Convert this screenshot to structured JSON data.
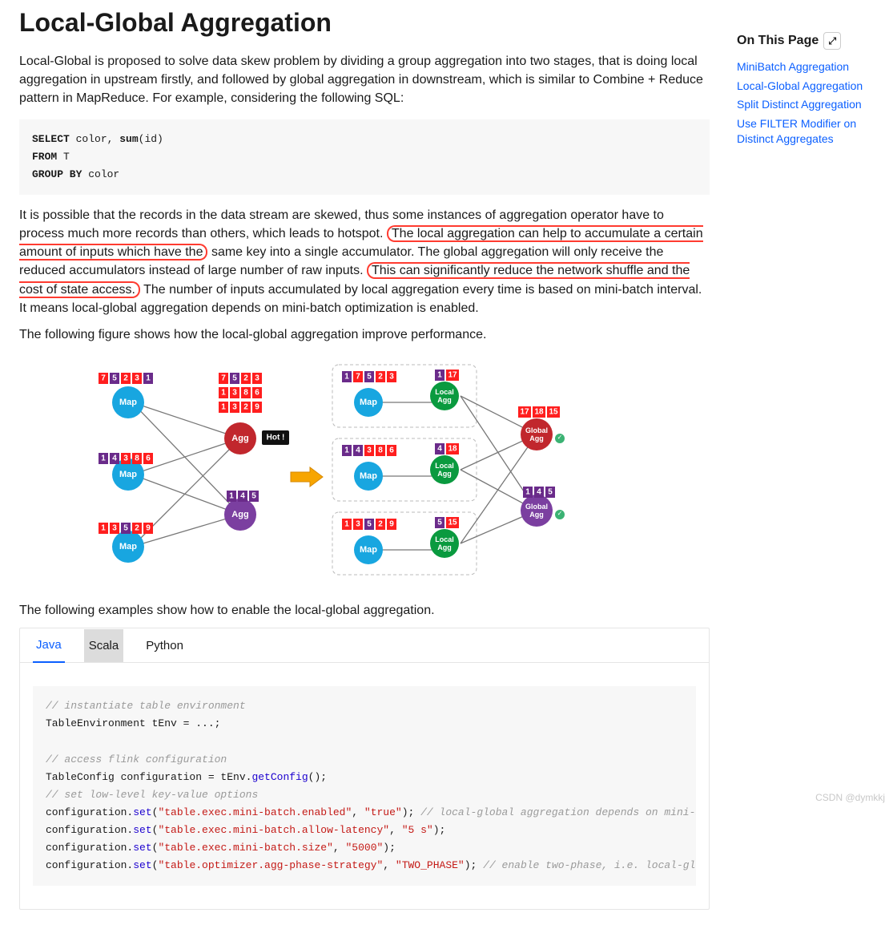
{
  "heading": "Local-Global Aggregation",
  "intro": "Local-Global is proposed to solve data skew problem by dividing a group aggregation into two stages, that is doing local aggregation in upstream firstly, and followed by global aggregation in downstream, which is similar to Combine + Reduce pattern in MapReduce. For example, considering the following SQL:",
  "sql": {
    "l1a": "SELECT",
    "l1b": " color, ",
    "l1c": "sum",
    "l1d": "(id)",
    "l2a": "FROM",
    "l2b": " T",
    "l3a": "GROUP BY",
    "l3b": " color"
  },
  "para2_a": "It is possible that the records in the data stream are skewed, thus some instances of aggregation operator have to process much more records than others, which leads to hotspot.",
  "para2_hl1": "The local aggregation can help to accumulate a certain amount of inputs which have the",
  "para2_b": "same key into a single accumulator. The global aggregation will only receive the reduced accumulators instead of large number of raw inputs.",
  "para2_hl2": "This can significantly reduce the network shuffle and the cost of state access.",
  "para2_c": "The number of inputs accumulated by local aggregation every time is based on mini-batch interval. It means local-global aggregation depends on mini-batch optimization is enabled.",
  "figCaption": "The following figure shows how the local-global aggregation improve performance.",
  "examplesCaption": "The following examples show how to enable the local-global aggregation.",
  "tabs": {
    "java": "Java",
    "scala": "Scala",
    "python": "Python"
  },
  "code": {
    "c1": "// instantiate table environment",
    "l2": "TableEnvironment tEnv = ...;",
    "c3": "// access flink configuration",
    "l4a": "TableConfig configuration = tEnv.",
    "l4m": "getConfig",
    "l4b": "();",
    "c5": "// set low-level key-value options",
    "l6a": "configuration.",
    "l6m": "set",
    "l6b": "(",
    "l6s1": "\"table.exec.mini-batch.enabled\"",
    "l6c": ", ",
    "l6s2": "\"true\"",
    "l6d": "); ",
    "l6cmt": "// local-global aggregation depends on mini-batch ",
    "l7a": "configuration.",
    "l7m": "set",
    "l7b": "(",
    "l7s1": "\"table.exec.mini-batch.allow-latency\"",
    "l7c": ", ",
    "l7s2": "\"5 s\"",
    "l7d": ");",
    "l8a": "configuration.",
    "l8m": "set",
    "l8b": "(",
    "l8s1": "\"table.exec.mini-batch.size\"",
    "l8c": ", ",
    "l8s2": "\"5000\"",
    "l8d": ");",
    "l9a": "configuration.",
    "l9m": "set",
    "l9b": "(",
    "l9s1": "\"table.optimizer.agg-phase-strategy\"",
    "l9c": ", ",
    "l9s2": "\"TWO_PHASE\"",
    "l9d": "); ",
    "l9cmt": "// enable two-phase, i.e. local-global ag"
  },
  "sidebar": {
    "title": "On This Page",
    "links": [
      "MiniBatch Aggregation",
      "Local-Global Aggregation",
      "Split Distinct Aggregation",
      "Use FILTER Modifier on Distinct Aggregates"
    ]
  },
  "watermark": "CSDN @dymkkj",
  "diagram": {
    "left": {
      "map1": [
        "7",
        "5",
        "2",
        "3",
        "1"
      ],
      "map2": [
        "1",
        "4",
        "3",
        "8",
        "6"
      ],
      "map3": [
        "1",
        "3",
        "5",
        "2",
        "9"
      ],
      "aggR_rows": [
        [
          "7",
          "5",
          "2",
          "3"
        ],
        [
          "1",
          "3",
          "8",
          "6"
        ],
        [
          "1",
          "3",
          "2",
          "9"
        ]
      ],
      "aggP": [
        "1",
        "4",
        "5"
      ],
      "hot": "Hot !",
      "labels": {
        "map": "Map",
        "agg": "Agg"
      }
    },
    "right": {
      "box1": {
        "in": [
          "1",
          "7",
          "5",
          "2",
          "3"
        ],
        "out": [
          "1",
          "17"
        ]
      },
      "box2": {
        "in": [
          "1",
          "4",
          "3",
          "8",
          "6"
        ],
        "out": [
          "4",
          "18"
        ]
      },
      "box3": {
        "in": [
          "1",
          "3",
          "5",
          "2",
          "9"
        ],
        "out": [
          "5",
          "15"
        ]
      },
      "globalR": [
        "17",
        "18",
        "15"
      ],
      "globalP": [
        "1",
        "4",
        "5"
      ],
      "labels": {
        "map": "Map",
        "local": "Local Agg",
        "global": "Global Agg"
      }
    }
  }
}
